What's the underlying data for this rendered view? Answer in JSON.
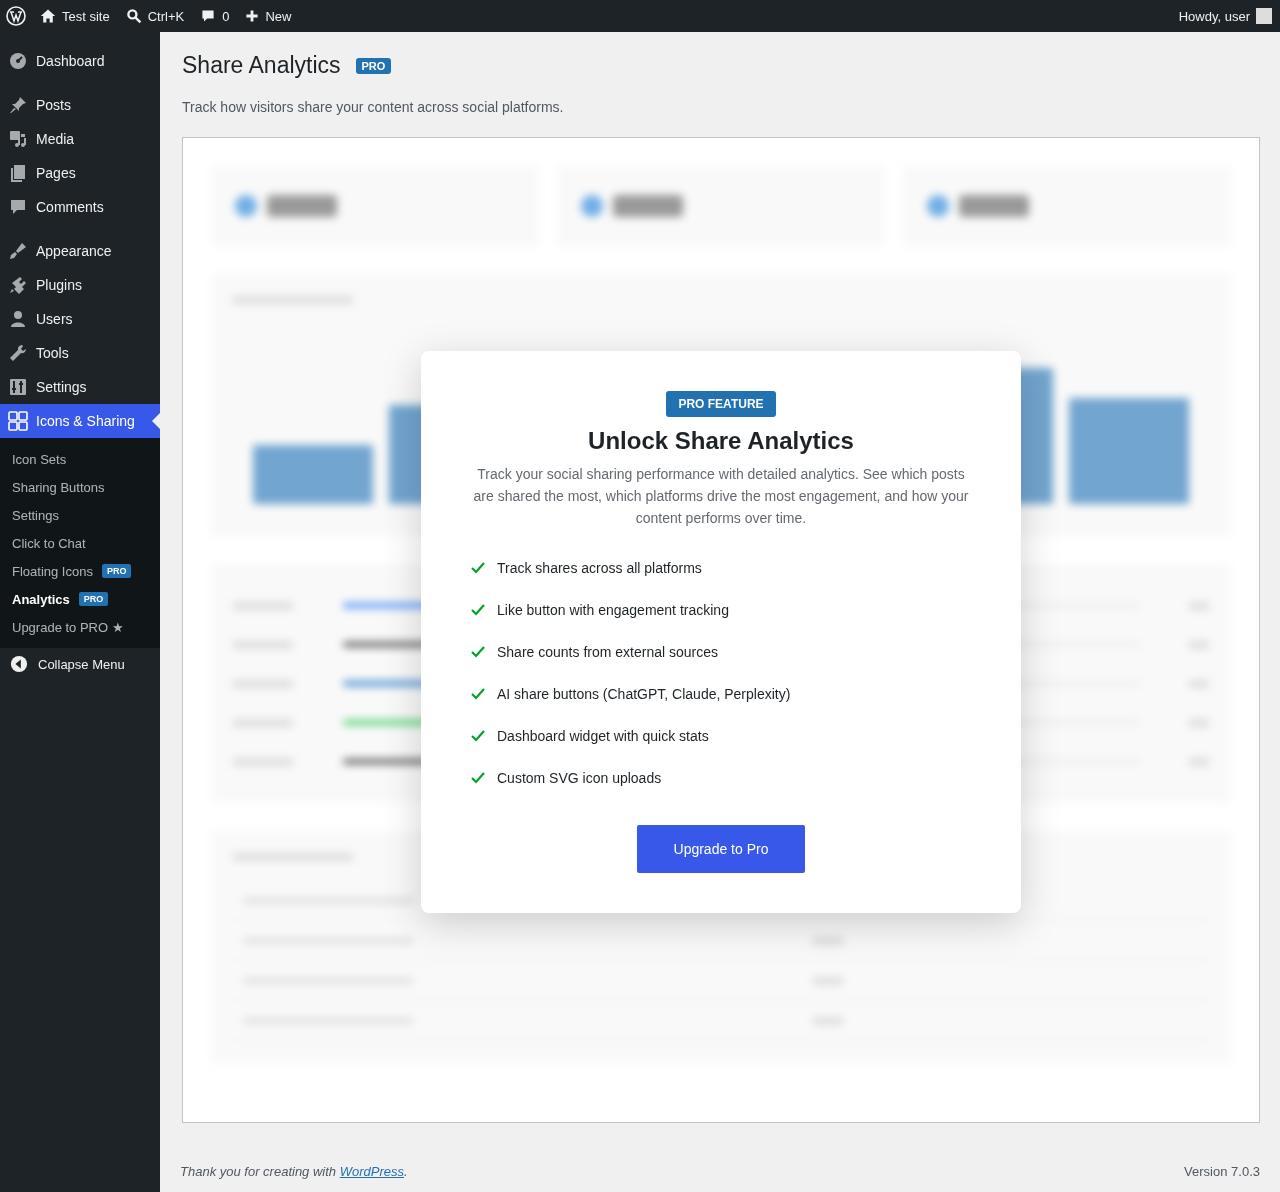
{
  "admin_bar": {
    "site": "Test site",
    "search": "Ctrl+K",
    "comments": "0",
    "new": "New",
    "greeting": "Howdy, user"
  },
  "menu_groups": [
    [
      {
        "label": "Dashboard",
        "selected": false
      }
    ],
    [
      {
        "label": "Posts",
        "selected": false
      },
      {
        "label": "Media",
        "selected": false
      },
      {
        "label": "Pages",
        "selected": false
      },
      {
        "label": "Comments",
        "selected": false
      }
    ],
    [
      {
        "label": "Appearance",
        "selected": false
      },
      {
        "label": "Plugins",
        "selected": false
      },
      {
        "label": "Users",
        "selected": false
      },
      {
        "label": "Tools",
        "selected": false
      },
      {
        "label": "Settings",
        "selected": false
      },
      {
        "label": "Icons & Sharing",
        "selected": true
      }
    ]
  ],
  "submenu": [
    {
      "label": "Icon Sets",
      "selected": false
    },
    {
      "label": "Sharing Buttons",
      "selected": false
    },
    {
      "label": "Settings",
      "selected": false
    },
    {
      "label": "Click to Chat",
      "selected": false
    },
    {
      "label": "Floating Icons",
      "badge": "PRO",
      "selected": false
    },
    {
      "label": "Analytics",
      "badge": "PRO",
      "selected": true
    },
    {
      "label": "Upgrade to PRO ★",
      "selected": false
    }
  ],
  "collapse": "Collapse Menu",
  "page": {
    "title": "Share Analytics",
    "badge": "PRO",
    "description": "Track how visitors share your content across social platforms."
  },
  "modal": {
    "badge": "PRO FEATURE",
    "title": "Unlock Share Analytics",
    "text": "Track your social sharing performance with detailed analytics. See which posts are shared the most, which platforms drive the most engagement, and how your content performs over time.",
    "features": [
      "Track shares across all platforms",
      "Like button with engagement tracking",
      "Share counts from external sources",
      "AI share buttons (ChatGPT, Claude, Perplexity)",
      "Dashboard widget with quick stats",
      "Custom SVG icon uploads"
    ],
    "button": "Upgrade to Pro"
  },
  "footer": {
    "prefix": "Thank you for creating with ",
    "link": "WordPress",
    "suffix": ".",
    "version": "Version 7.0.3"
  }
}
